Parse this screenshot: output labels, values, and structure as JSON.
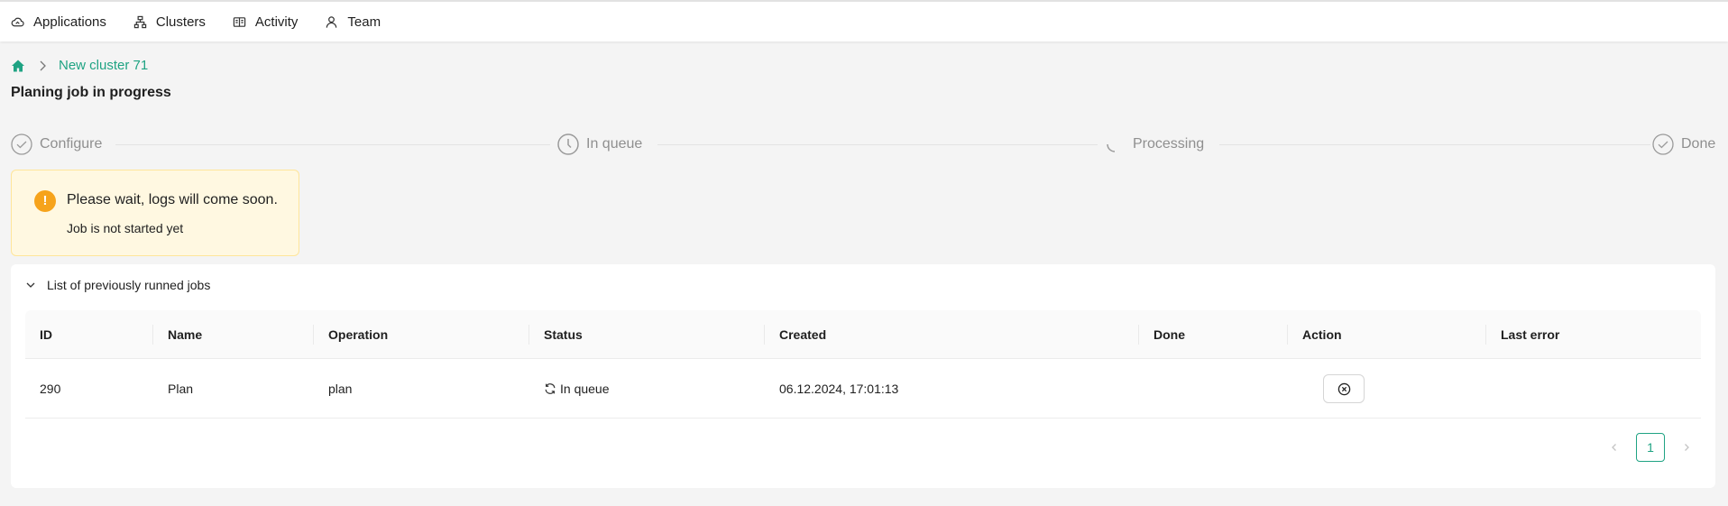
{
  "nav": {
    "items": [
      {
        "label": "Applications",
        "icon": "cloud-icon"
      },
      {
        "label": "Clusters",
        "icon": "sitemap-icon"
      },
      {
        "label": "Activity",
        "icon": "book-icon"
      },
      {
        "label": "Team",
        "icon": "user-icon"
      }
    ]
  },
  "breadcrumb": {
    "current": "New cluster 71"
  },
  "page": {
    "title": "Planing job in progress"
  },
  "steps": [
    {
      "label": "Configure",
      "icon": "check-circle-icon"
    },
    {
      "label": "In queue",
      "icon": "clock-icon"
    },
    {
      "label": "Processing",
      "icon": "loading-icon"
    },
    {
      "label": "Done",
      "icon": "check-circle-icon"
    }
  ],
  "alert": {
    "message": "Please wait, logs will come soon.",
    "description": "Job is not started yet",
    "icon": "exclamation-icon"
  },
  "jobs": {
    "title": "List of previously runned jobs",
    "columns": [
      "ID",
      "Name",
      "Operation",
      "Status",
      "Created",
      "Done",
      "Action",
      "Last error"
    ],
    "rows": [
      {
        "id": "290",
        "name": "Plan",
        "operation": "plan",
        "status": "In queue",
        "created": "06.12.2024, 17:01:13",
        "done": "",
        "last_error": ""
      }
    ],
    "pagination": {
      "current_page": "1"
    }
  },
  "colors": {
    "accent": "#1fa383",
    "warning": "#f6a31b",
    "alert_bg": "#fff8e1"
  }
}
